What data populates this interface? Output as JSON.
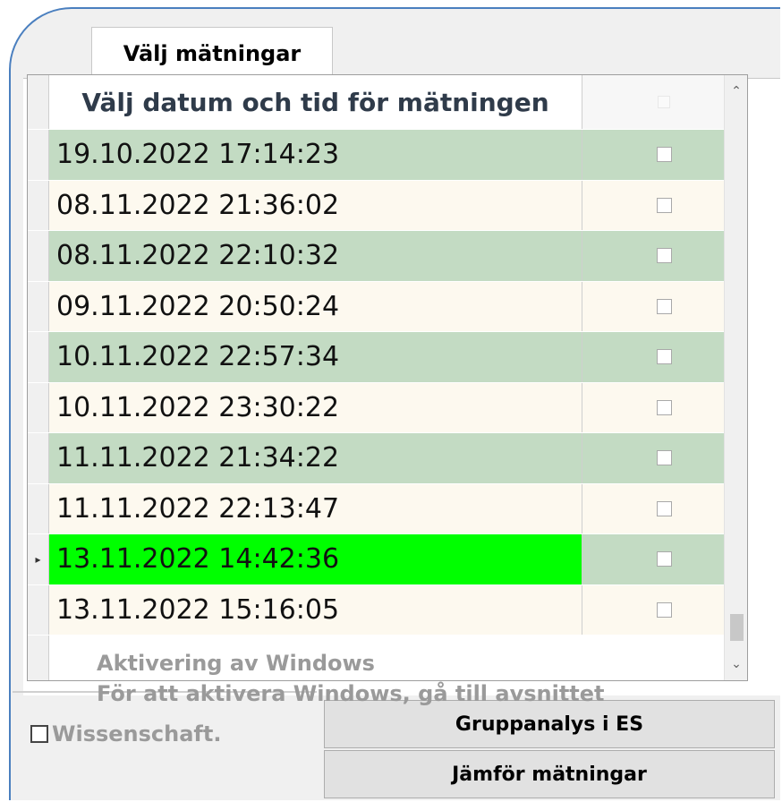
{
  "tab": {
    "label": "Välj mätningar"
  },
  "grid": {
    "header_date": "Välj datum och tid för mätningen",
    "rows": [
      {
        "datetime": "19.10.2022 17:14:23",
        "style": "even"
      },
      {
        "datetime": "08.11.2022 21:36:02",
        "style": "odd"
      },
      {
        "datetime": "08.11.2022 22:10:32",
        "style": "even"
      },
      {
        "datetime": "09.11.2022 20:50:24",
        "style": "odd"
      },
      {
        "datetime": "10.11.2022 22:57:34",
        "style": "even"
      },
      {
        "datetime": "10.11.2022 23:30:22",
        "style": "odd"
      },
      {
        "datetime": "11.11.2022 21:34:22",
        "style": "even"
      },
      {
        "datetime": "11.11.2022 22:13:47",
        "style": "odd"
      },
      {
        "datetime": "13.11.2022 14:42:36",
        "style": "even",
        "selected": true
      },
      {
        "datetime": "13.11.2022 15:16:05",
        "style": "odd"
      }
    ],
    "current_row_marker": "▸"
  },
  "watermark": {
    "line1": "Aktivering av Windows",
    "line2": "För att aktivera Windows, gå till avsnittet"
  },
  "checkbox": {
    "label": "Wissenschaft.",
    "checked": false
  },
  "buttons": {
    "group_analysis": "Gruppanalys i ES",
    "compare": "Jämför mätningar"
  },
  "colors": {
    "row_even": "#c3dbc3",
    "row_odd": "#fdf9ef",
    "selected": "#00ff00",
    "frame_accent": "#4a7fbf"
  }
}
